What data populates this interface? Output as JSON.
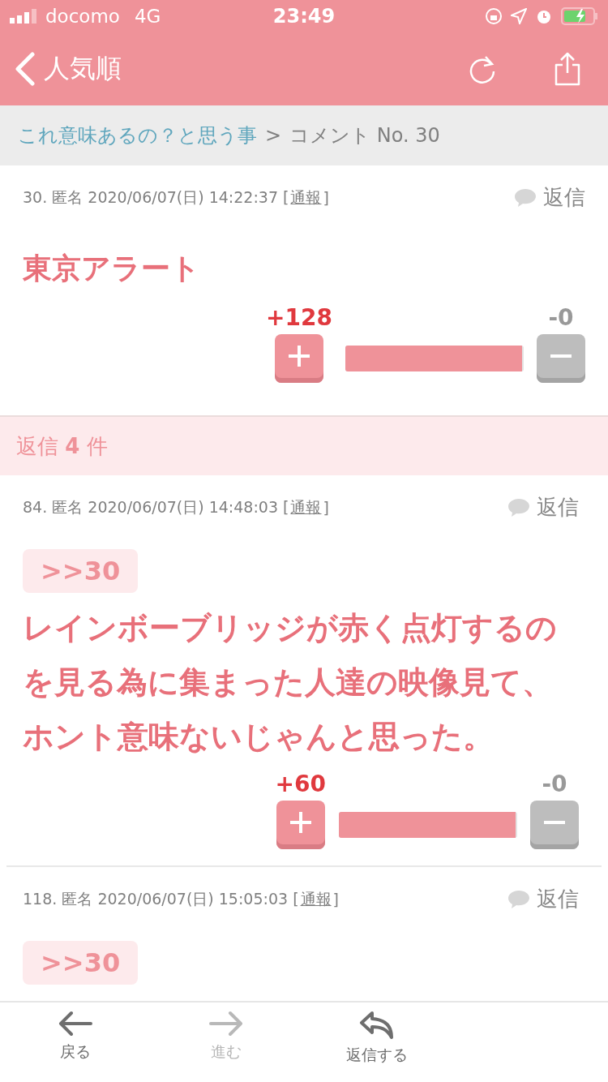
{
  "status_bar": {
    "carrier": "docomo",
    "network": "4G",
    "time": "23:49"
  },
  "nav": {
    "back_label": "人気順"
  },
  "breadcrumb": {
    "link": "これ意味あるの？と思う事",
    "separator": ">",
    "current": "コメント No. 30"
  },
  "main_comment": {
    "meta": "30. 匿名 2020/06/07(日) 14:22:37",
    "report_open": "[",
    "report": "通報",
    "report_close": "]",
    "reply": "返信",
    "body": "東京アラート",
    "votes": {
      "plus": "+128",
      "minus": "-0",
      "level": 0.99
    }
  },
  "reply_count": "返信 **4** 件",
  "replies": [
    {
      "meta": "84. 匿名 2020/06/07(日) 14:48:03",
      "report_open": "[",
      "report": "通報",
      "report_close": "]",
      "reply": "返信",
      "anchor": ">>30",
      "body": "レインボーブリッジが赤く点灯するのを見る為に集まった人達の映像見て、ホント意味ないじゃんと思った。",
      "votes": {
        "plus": "+60",
        "minus": "-0",
        "level": 0.99
      }
    },
    {
      "meta": "118. 匿名 2020/06/07(日) 15:05:03",
      "report_open": "[",
      "report": "通報",
      "report_close": "]",
      "reply": "返信",
      "anchor": ">>30"
    }
  ],
  "toolbar": [
    {
      "label": "戻る",
      "kind": "back",
      "disabled": false
    },
    {
      "label": "進む",
      "kind": "forward",
      "disabled": true
    },
    {
      "label": "返信する",
      "kind": "reply",
      "disabled": false
    }
  ]
}
